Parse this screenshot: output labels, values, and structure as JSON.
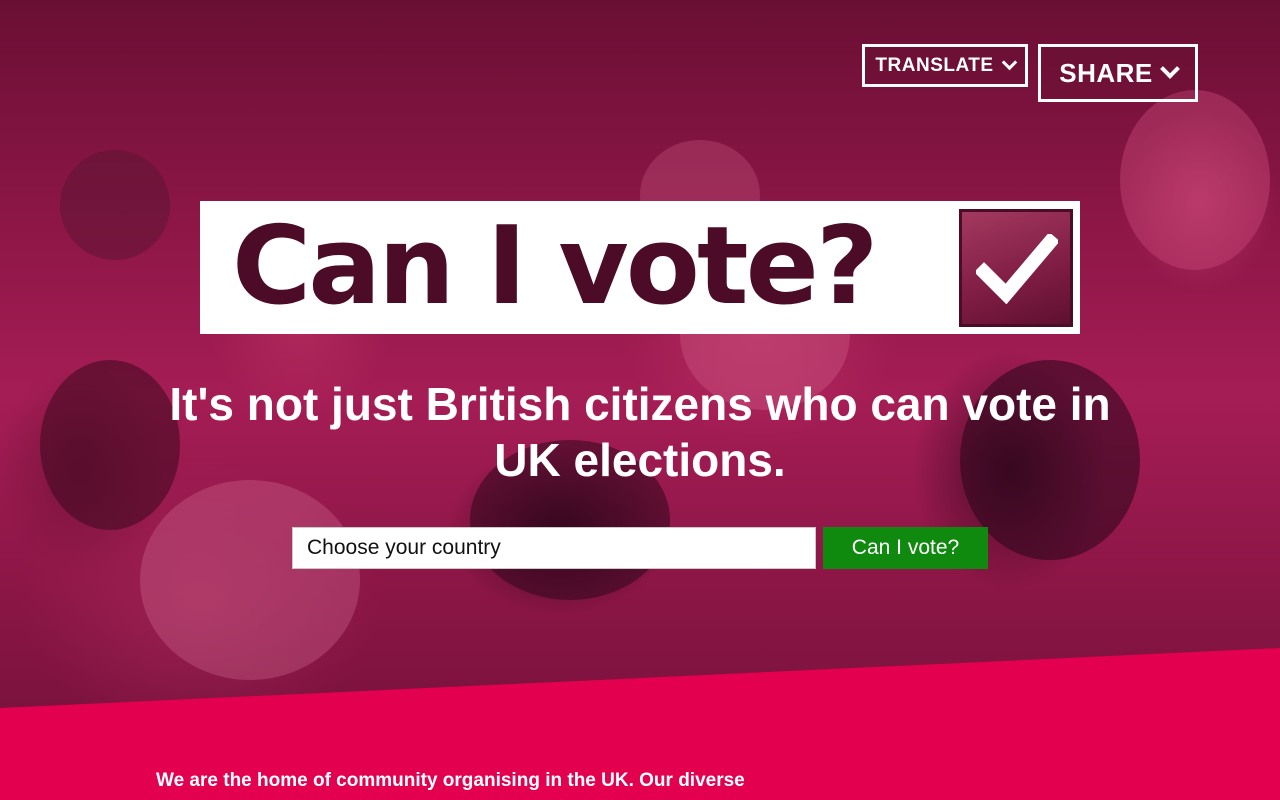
{
  "header": {
    "translate_label": "TRANSLATE",
    "share_label": "SHARE"
  },
  "hero": {
    "title": "Can I vote?",
    "subtitle": "It's not just British citizens who can vote in UK elections.",
    "search": {
      "placeholder": "Choose your country",
      "button_label": "Can I vote?"
    }
  },
  "intro": {
    "text": "We are the home of community organising in the UK. Our diverse"
  },
  "colors": {
    "brand_pink": "#e2004f",
    "title_dark": "#4c0b26",
    "button_green": "#0f8a0f"
  }
}
